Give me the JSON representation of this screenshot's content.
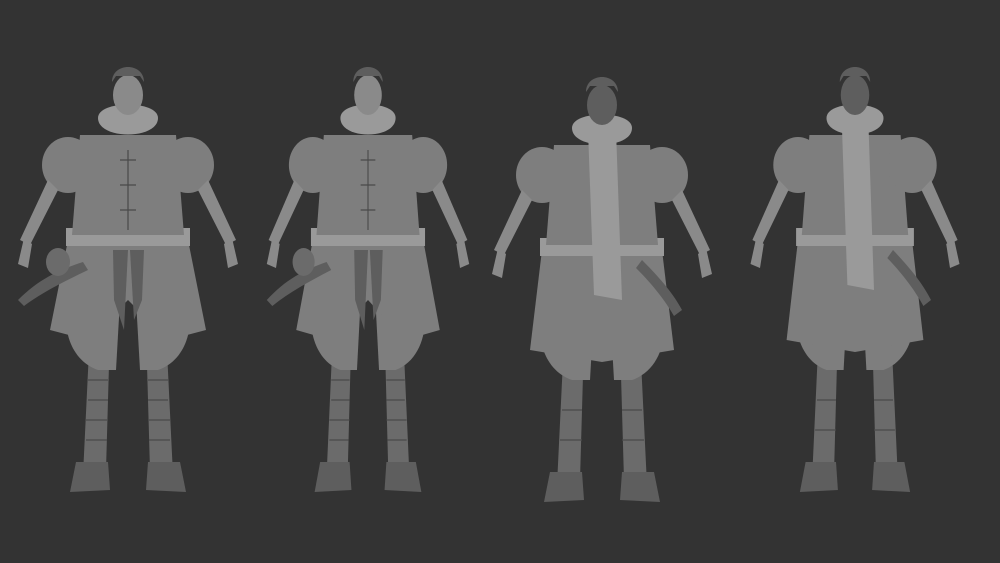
{
  "scene": {
    "background_color": "#333333",
    "model_color": "#808080",
    "figures": [
      {
        "view": "front"
      },
      {
        "view": "three-quarter-front"
      },
      {
        "view": "back"
      },
      {
        "view": "three-quarter-back"
      }
    ]
  }
}
